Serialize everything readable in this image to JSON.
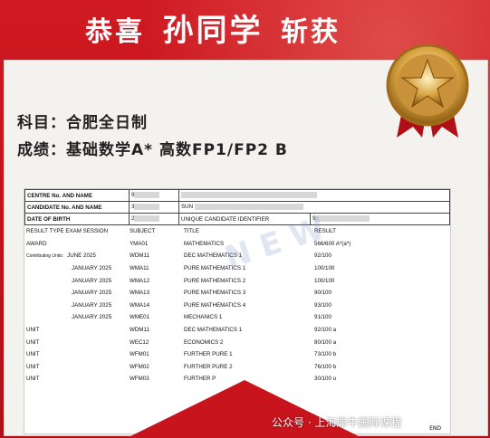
{
  "headline": {
    "part1": "恭喜",
    "name": "孙同学",
    "part2": "斩获"
  },
  "info": {
    "line1": "科目：合肥全日制",
    "line2": "成绩：基础数学A*   高数FP1/FP2  B"
  },
  "sheet": {
    "header": [
      {
        "k": "CENTRE No. AND NAME",
        "v": "9",
        "extra": ""
      },
      {
        "k": "CANDIDATE No. AND NAME",
        "v": "3",
        "extra": "SUN"
      },
      {
        "k": "DATE OF BIRTH",
        "v": "2",
        "extra": "UNIQUE CANDIDATE IDENTIFIER",
        "extra2": "9"
      }
    ],
    "columns": [
      "RESULT TYPE  EXAM SESSION",
      "SUBJECT",
      "TITLE",
      "RESULT"
    ],
    "rows": [
      {
        "type": "AWARD",
        "session": "",
        "subject": "YMA01",
        "title": "MATHEMATICS",
        "result": "566/600 A*(a*)",
        "sub": false
      },
      {
        "type": "Contributing Units:",
        "session": "JUNE 2025",
        "subject": "WDM11",
        "title": "DEC MATHEMATICS 1",
        "result": "92/100",
        "sub": false
      },
      {
        "type": "",
        "session": "JANUARY 2025",
        "subject": "WMA11",
        "title": "PURE MATHEMATICS 1",
        "result": "100/100",
        "sub": true
      },
      {
        "type": "",
        "session": "JANUARY 2025",
        "subject": "WMA12",
        "title": "PURE MATHEMATICS 2",
        "result": "100/100",
        "sub": true
      },
      {
        "type": "",
        "session": "JANUARY 2025",
        "subject": "WMA13",
        "title": "PURE MATHEMATICS 3",
        "result": "90/100",
        "sub": true
      },
      {
        "type": "",
        "session": "JANUARY 2025",
        "subject": "WMA14",
        "title": "PURE MATHEMATICS 4",
        "result": "93/100",
        "sub": true
      },
      {
        "type": "",
        "session": "JANUARY 2025",
        "subject": "WME01",
        "title": "MECHANICS 1",
        "result": "91/100",
        "sub": true
      },
      {
        "type": "UNIT",
        "session": "",
        "subject": "WDM11",
        "title": "DEC MATHEMATICS 1",
        "result": "92/100 a",
        "sub": false
      },
      {
        "type": "UNIT",
        "session": "",
        "subject": "WEC12",
        "title": "ECONOMICS 2",
        "result": "80/100 a",
        "sub": false
      },
      {
        "type": "UNIT",
        "session": "",
        "subject": "WFM01",
        "title": "FURTHER PURE 1",
        "result": "73/100 b",
        "sub": false
      },
      {
        "type": "UNIT",
        "session": "",
        "subject": "WFM02",
        "title": "FURTHER PURE 2",
        "result": "76/100 b",
        "sub": false
      },
      {
        "type": "UNIT",
        "session": "",
        "subject": "WFM03",
        "title": "FURTHER P",
        "result": "30/100 u",
        "sub": false
      }
    ],
    "end": "END"
  },
  "footer": "公众号 · 上海犀牛国际课程",
  "colors": {
    "brand_red": "#c8141c",
    "gold": "#d9a441"
  }
}
